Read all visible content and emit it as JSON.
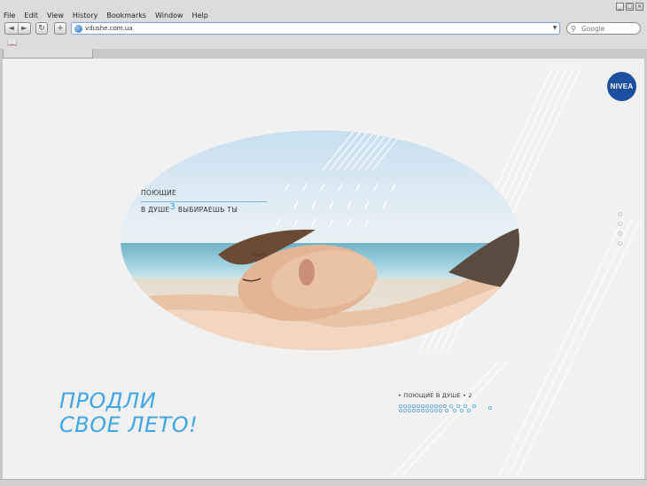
{
  "browser": {
    "menu": [
      "File",
      "Edit",
      "View",
      "History",
      "Bookmarks",
      "Window",
      "Help"
    ],
    "url": "vdushe.com.ua",
    "search_placeholder": "Google",
    "nav": {
      "back": "◄",
      "forward": "►",
      "reload": "↻",
      "add": "+"
    }
  },
  "page": {
    "logo": "NIVEA",
    "headline_top": "ПОЮЩИЕ",
    "headline_bottom_prefix": "В ДУШЕ",
    "headline_superscript": "3",
    "headline_bottom_suffix": " ВЫБИРАЕШЬ ТЫ",
    "promo_line1": "ПРОДЛИ",
    "promo_line2": "СВОЕ ЛЕТО!",
    "playlist_label": "• ПОЮЩИЕ В ДУШЕ • 2",
    "side_nav_count": 4,
    "accent_color": "#3fa6e6",
    "brand_color": "#1d4fa1"
  }
}
